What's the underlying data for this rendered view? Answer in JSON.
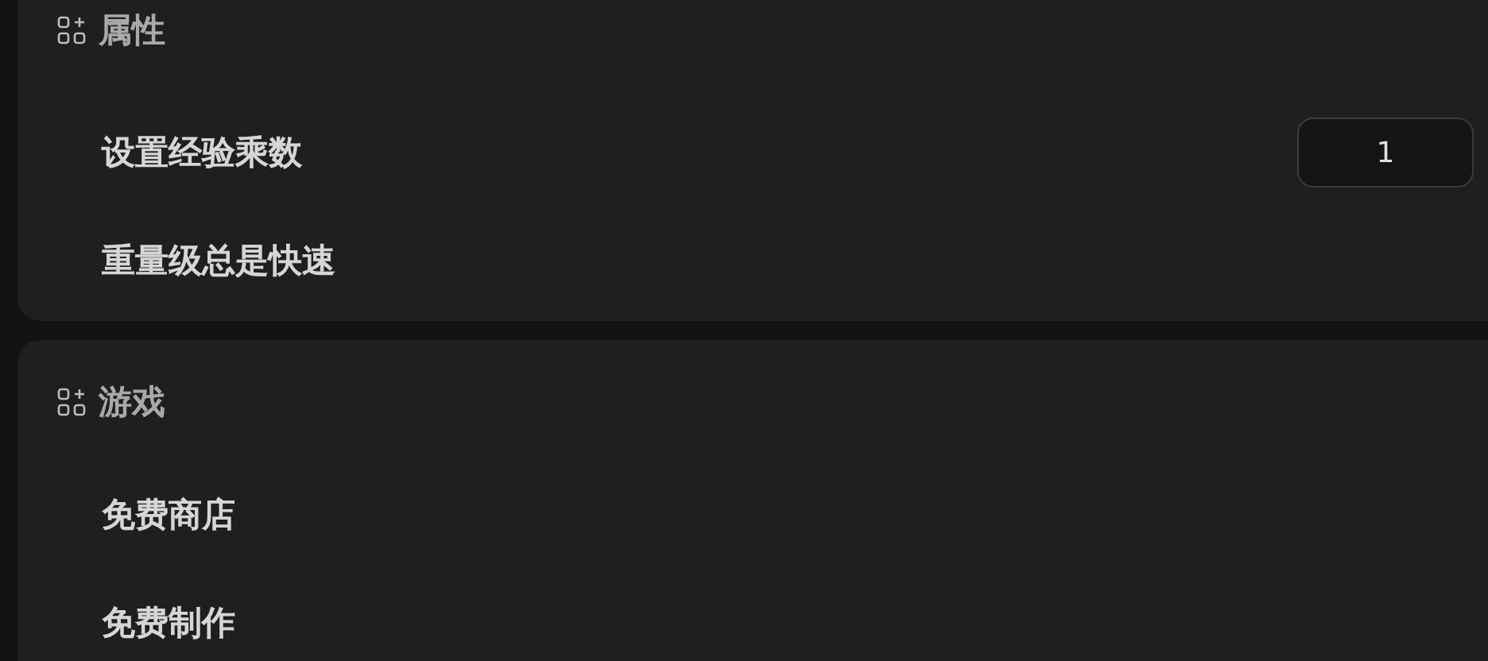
{
  "sections": [
    {
      "title": "属性",
      "items": [
        {
          "kind": "number",
          "label": "设置经验乘数",
          "value": "1"
        },
        {
          "kind": "plain",
          "label": "重量级总是快速"
        }
      ]
    },
    {
      "title": "游戏",
      "items": [
        {
          "kind": "plain",
          "label": "免费商店"
        },
        {
          "kind": "plain",
          "label": "免费制作"
        }
      ]
    }
  ]
}
